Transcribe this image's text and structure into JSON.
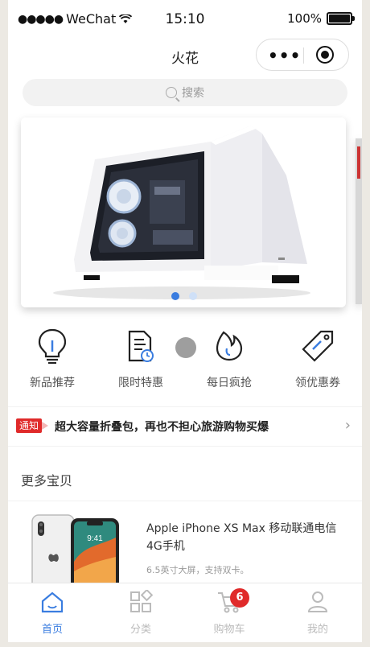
{
  "status_bar": {
    "carrier": "WeChat",
    "time": "15:10",
    "battery": "100%"
  },
  "nav": {
    "title": "火花"
  },
  "search": {
    "placeholder": "搜索"
  },
  "banner": {
    "slide_count": 2,
    "active_index": 0
  },
  "quick_links": [
    {
      "label": "新品推荐",
      "icon": "lightbulb-icon"
    },
    {
      "label": "限时特惠",
      "icon": "document-clock-icon"
    },
    {
      "label": "每日疯抢",
      "icon": "flame-icon"
    },
    {
      "label": "领优惠券",
      "icon": "coupon-tag-icon"
    }
  ],
  "notice": {
    "badge": "通知",
    "text": "超大容量折叠包，再也不担心旅游购物买爆"
  },
  "section": {
    "title": "更多宝贝"
  },
  "products": [
    {
      "name": "Apple iPhone XS Max 移动联通电信4G手机",
      "desc": "6.5英寸大屏，支持双卡。"
    }
  ],
  "tabbar": {
    "items": [
      {
        "label": "首页",
        "icon": "home-icon",
        "active": true
      },
      {
        "label": "分类",
        "icon": "category-grid-icon",
        "active": false
      },
      {
        "label": "购物车",
        "icon": "cart-icon",
        "active": false
      },
      {
        "label": "我的",
        "icon": "user-icon",
        "active": false
      }
    ],
    "cart_count": "6"
  },
  "colors": {
    "accent": "#3a7de0",
    "badge_red": "#e02a2a"
  }
}
